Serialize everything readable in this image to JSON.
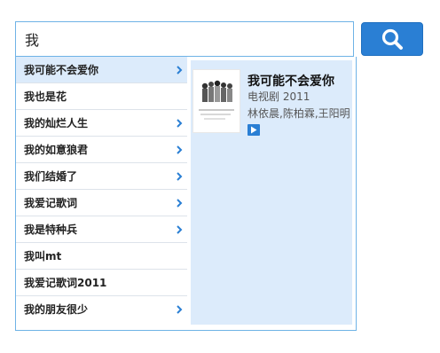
{
  "search": {
    "value": "我",
    "icon": "search-icon",
    "button_color": "#2a7fd4"
  },
  "suggestions": [
    {
      "label": "我可能不会爱你",
      "has_arrow": true,
      "active": true
    },
    {
      "label": "我也是花",
      "has_arrow": false
    },
    {
      "label": "我的灿烂人生",
      "has_arrow": true
    },
    {
      "label": "我的如意狼君",
      "has_arrow": true
    },
    {
      "label": "我们结婚了",
      "has_arrow": true
    },
    {
      "label": "我爱记歌词",
      "has_arrow": true
    },
    {
      "label": "我是特种兵",
      "has_arrow": true
    },
    {
      "label": "我叫mt",
      "has_arrow": false
    },
    {
      "label": "我爱记歌词2011",
      "has_arrow": false
    },
    {
      "label": "我的朋友很少",
      "has_arrow": true
    }
  ],
  "preview": {
    "title": "我可能不会爱你",
    "type_year": "电视剧 2011",
    "cast": "林依晨,陈柏霖,王阳明",
    "play_icon": "play-icon",
    "poster_icon": "poster-image"
  }
}
